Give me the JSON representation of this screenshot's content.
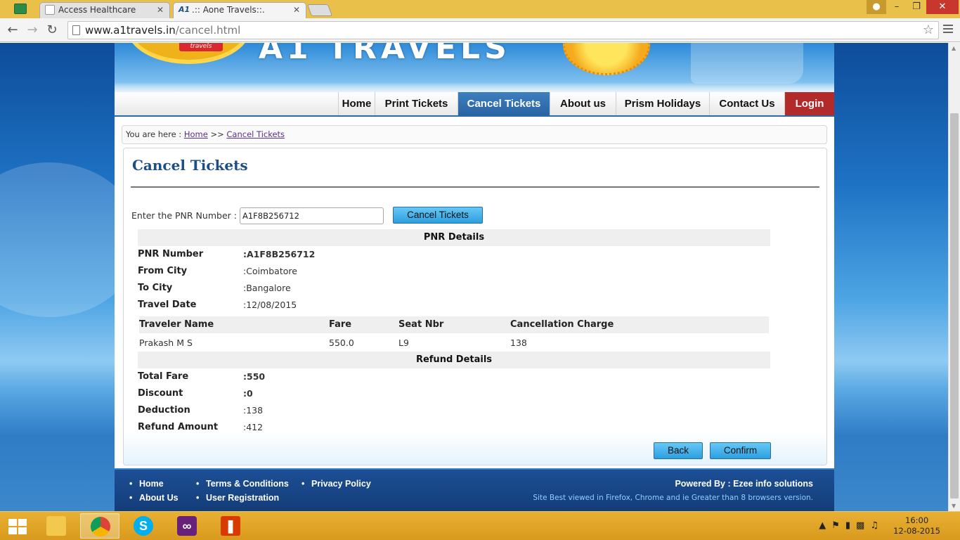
{
  "browser": {
    "tabs": [
      {
        "title": "Access Healthcare",
        "icon": "sheets-icon",
        "active": false
      },
      {
        "title": ".:: Aone Travels::.",
        "icon_text": "A1",
        "active": true
      }
    ],
    "url_host": "www.a1travels.in",
    "url_path": "/cancel.html"
  },
  "site": {
    "banner": {
      "logo_tag": "travels",
      "wordmark": "A1 TRAVELS"
    },
    "nav": {
      "home": "Home",
      "print": "Print Tickets",
      "cancel": "Cancel Tickets",
      "about": "About us",
      "prism": "Prism Holidays",
      "contact": "Contact Us",
      "login": "Login"
    },
    "breadcrumb": {
      "prefix": "You are here :",
      "home": "Home",
      "sep": ">>",
      "current": "Cancel Tickets"
    },
    "panel": {
      "title": "Cancel Tickets",
      "pnr_label": "Enter the PNR Number :",
      "pnr_value": "A1F8B256712",
      "cancel_button": "Cancel Tickets",
      "pnr_details_heading": "PNR Details",
      "pnr_fields": [
        {
          "label": "PNR Number",
          "value": ":A1F8B256712"
        },
        {
          "label": "From City",
          "value": ":Coimbatore"
        },
        {
          "label": "To City",
          "value": ":Bangalore"
        },
        {
          "label": "Travel Date",
          "value": ":12/08/2015"
        }
      ],
      "traveler_table": {
        "headers": [
          "Traveler Name",
          "Fare",
          "Seat Nbr",
          "Cancellation Charge"
        ],
        "rows": [
          [
            "Prakash M S",
            "550.0",
            "L9",
            "138"
          ]
        ]
      },
      "refund_heading": "Refund Details",
      "refund_fields": [
        {
          "label": "Total Fare",
          "value": ":550"
        },
        {
          "label": "Discount",
          "value": ":0"
        },
        {
          "label": "Deduction",
          "value": ":138"
        },
        {
          "label": "Refund Amount",
          "value": ":412"
        }
      ],
      "back_button": "Back",
      "confirm_button": "Confirm"
    },
    "footer": {
      "links": {
        "home": "Home",
        "about": "About Us",
        "terms": "Terms & Conditions",
        "registration": "User Registration",
        "privacy": "Privacy Policy"
      },
      "powered_by": "Powered By : Ezee info solutions",
      "best_viewed": "Site Best viewed in Firefox, Chrome and ie Greater than 8 browsers version."
    }
  },
  "taskbar": {
    "apps": [
      "file-explorer-icon",
      "chrome-icon",
      "skype-icon",
      "visual-studio-icon",
      "office-icon"
    ],
    "time": "16:00",
    "date": "12-08-2015"
  },
  "colors": {
    "accent_blue": "#2a63a2",
    "login_red": "#b32a2a",
    "title_blue": "#1d4f86",
    "taskbar": "#e0a628"
  }
}
